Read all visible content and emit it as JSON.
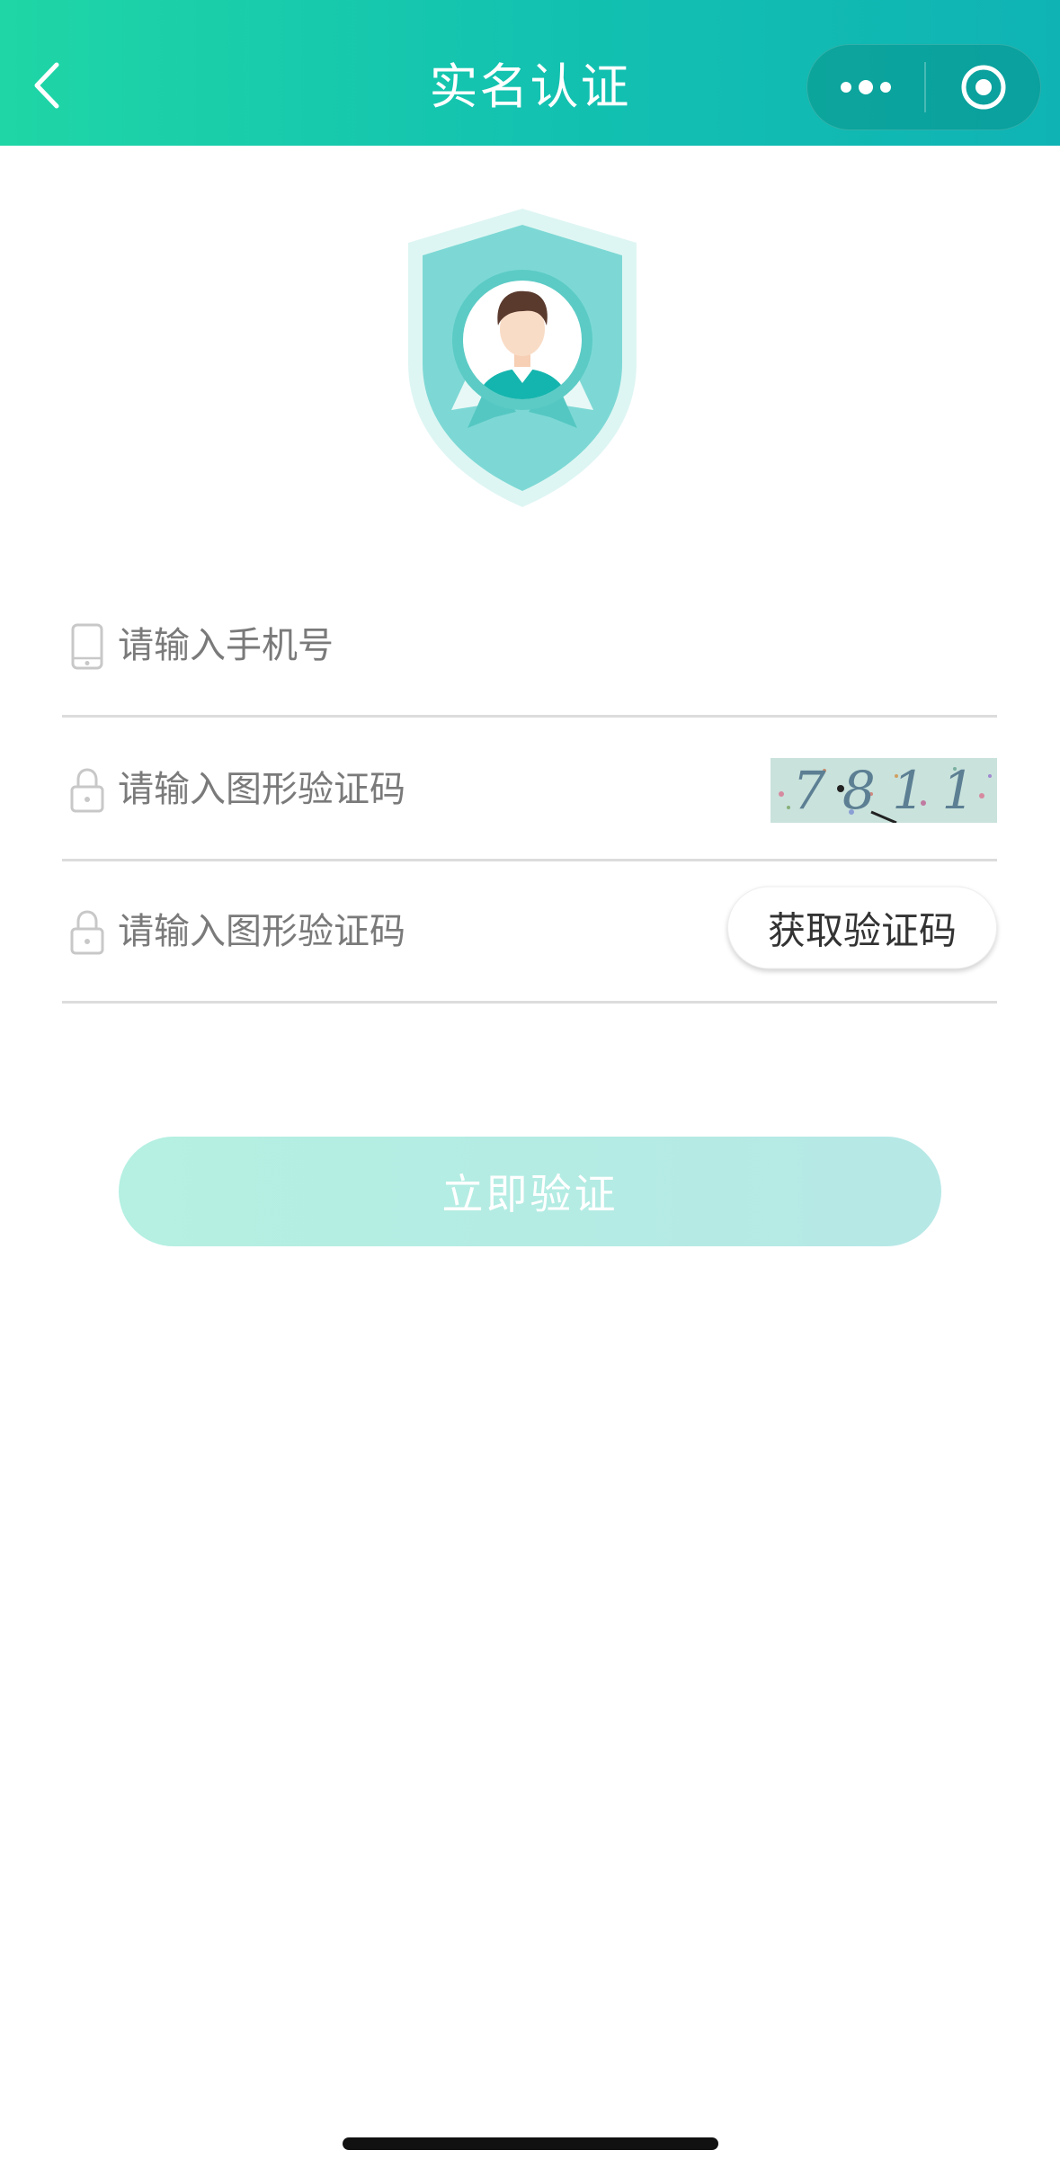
{
  "nav": {
    "title": "实名认证",
    "back_icon": "chevron-left-icon",
    "more_icon": "more-dots-icon",
    "close_icon": "target-circle-icon"
  },
  "illustration": {
    "icon": "shield-avatar-icon"
  },
  "form": {
    "phone": {
      "icon": "phone-icon",
      "placeholder": "请输入手机号",
      "value": ""
    },
    "image_code": {
      "icon": "lock-icon",
      "placeholder": "请输入图形验证码",
      "value": "",
      "captcha_text": "7 8 1 1"
    },
    "sms_code": {
      "icon": "lock-icon",
      "placeholder": "请输入图形验证码",
      "value": "",
      "button_label": "获取验证码"
    }
  },
  "submit": {
    "label": "立即验证"
  },
  "colors": {
    "header_gradient_start": "#1fd6a6",
    "header_gradient_end": "#0fb3b4",
    "submit_disabled": "#b5ede3",
    "divider": "#dcdcdc"
  }
}
